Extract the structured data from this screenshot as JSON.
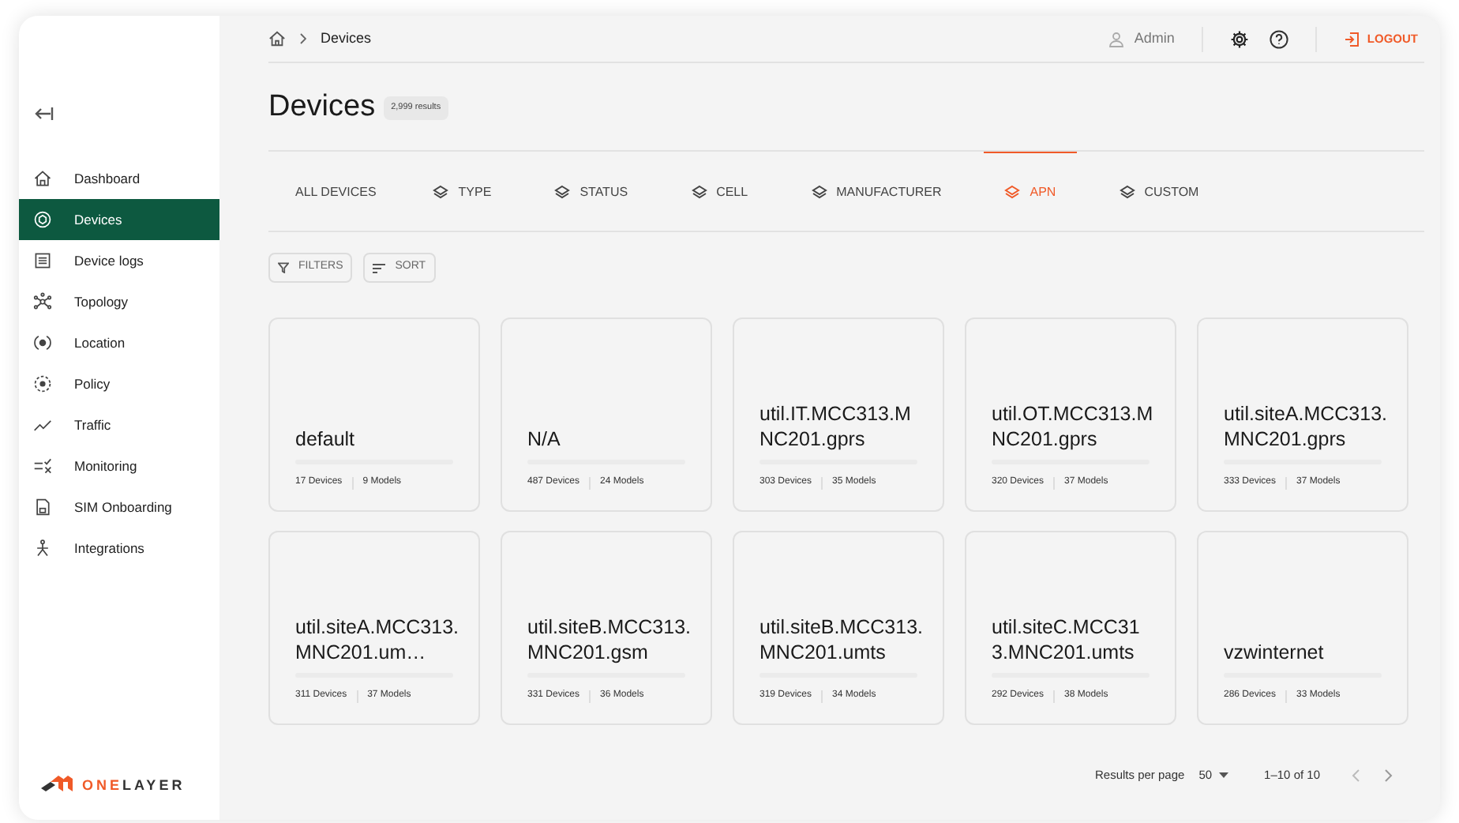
{
  "sidebar": {
    "items": [
      {
        "label": "Dashboard",
        "selected": false
      },
      {
        "label": "Devices",
        "selected": true
      },
      {
        "label": "Device logs",
        "selected": false
      },
      {
        "label": "Topology",
        "selected": false
      },
      {
        "label": "Location",
        "selected": false
      },
      {
        "label": "Policy",
        "selected": false
      },
      {
        "label": "Traffic",
        "selected": false
      },
      {
        "label": "Monitoring",
        "selected": false
      },
      {
        "label": "SIM Onboarding",
        "selected": false
      },
      {
        "label": "Integrations",
        "selected": false
      }
    ],
    "logo": {
      "parts": [
        "ONE",
        "LAYER"
      ]
    }
  },
  "breadcrumb": [
    "Devices"
  ],
  "header": {
    "user": "Admin",
    "logout": "LOGOUT"
  },
  "page": {
    "title": "Devices",
    "count": "2,999 results"
  },
  "tabs": [
    {
      "label": "ALL DEVICES",
      "kind": "plain",
      "selected": false
    },
    {
      "label": "TYPE",
      "kind": "group",
      "selected": false
    },
    {
      "label": "STATUS",
      "kind": "group",
      "selected": false
    },
    {
      "label": "CELL",
      "kind": "group",
      "selected": false
    },
    {
      "label": "MANUFACTURER",
      "kind": "group",
      "selected": false
    },
    {
      "label": "APN",
      "kind": "group",
      "selected": true
    },
    {
      "label": "CUSTOM",
      "kind": "group",
      "selected": false
    }
  ],
  "toolbar": {
    "filters": "FILTERS",
    "sort": "SORT"
  },
  "cards": [
    {
      "title": "default",
      "devices": "17 Devices",
      "models": "9 Models"
    },
    {
      "title": "N/A",
      "devices": "487 Devices",
      "models": "24 Models"
    },
    {
      "title": "util.IT.MCC313.MNC201.gprs",
      "devices": "303 Devices",
      "models": "35 Models"
    },
    {
      "title": "util.OT.MCC313.MNC201.gprs",
      "devices": "320 Devices",
      "models": "37 Models"
    },
    {
      "title": "util.siteA.MCC313.MNC201.gprs",
      "devices": "333 Devices",
      "models": "37 Models"
    },
    {
      "title": "util.siteA.MCC313.MNC201.um…",
      "devices": "311 Devices",
      "models": "37 Models"
    },
    {
      "title": "util.siteB.MCC313.MNC201.gsm",
      "devices": "331 Devices",
      "models": "36 Models"
    },
    {
      "title": "util.siteB.MCC313.MNC201.umts",
      "devices": "319 Devices",
      "models": "34 Models"
    },
    {
      "title": "util.siteC.MCC313.MNC201.umts",
      "devices": "292 Devices",
      "models": "38 Models"
    },
    {
      "title": "vzwinternet",
      "devices": "286 Devices",
      "models": "33 Models"
    }
  ],
  "pagination": {
    "label": "Results per page",
    "per_page": "50",
    "range": "1–10 of 10"
  }
}
